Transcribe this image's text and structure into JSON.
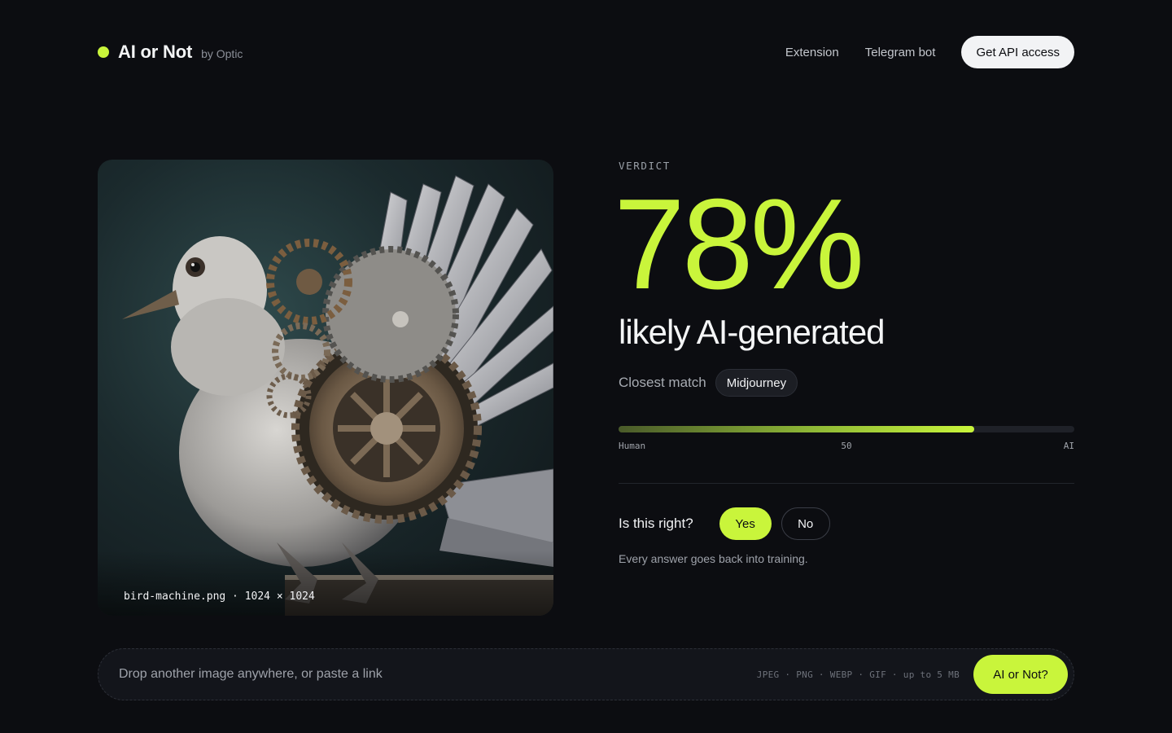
{
  "header": {
    "brand_name": "AI or Not",
    "brand_by": "by Optic",
    "nav": [
      "Extension",
      "Telegram bot"
    ],
    "cta_label": "Get API access"
  },
  "image": {
    "caption": "bird-machine.png · 1024 × 1024",
    "subject": "mechanical-bird-illustration"
  },
  "verdict": {
    "label": "VERDICT",
    "percent": "78%",
    "percent_value": 0.78,
    "text": "likely AI-generated",
    "match_label": "Closest match",
    "match_value": "Midjourney",
    "meter": {
      "fill_fraction": 0.78,
      "min_label": "Human",
      "mid_label": "50",
      "max_label": "AI"
    }
  },
  "feedback": {
    "question": "Is this right?",
    "yes_label": "Yes",
    "no_label": "No",
    "note": "Every answer goes back into training."
  },
  "dropbar": {
    "placeholder": "Drop another image anywhere, or paste a link",
    "formats": "JPEG · PNG · WEBP · GIF · up to 5 MB",
    "button_label": "AI or Not?"
  },
  "colors": {
    "accent": "#c9f53b",
    "background": "#0c0d11"
  }
}
